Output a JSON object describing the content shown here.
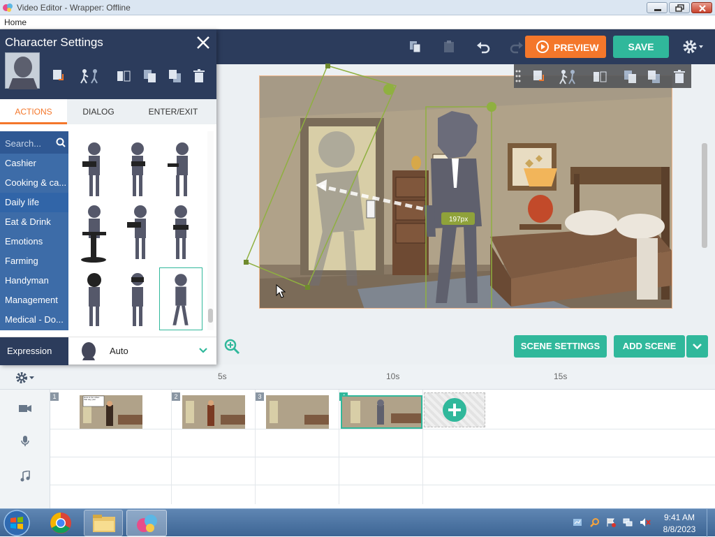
{
  "window": {
    "title": "Video Editor - Wrapper: Offline"
  },
  "menu": {
    "home": "Home"
  },
  "toolbar": {
    "preview_label": "PREVIEW",
    "save_label": "SAVE"
  },
  "panel": {
    "title": "Character Settings",
    "tabs": [
      "ACTIONS",
      "DIALOG",
      "ENTER/EXIT"
    ],
    "search_placeholder": "Search...",
    "categories": [
      "Cashier",
      "Cooking & ca...",
      "Daily life",
      "Eat & Drink",
      "Emotions",
      "Farming",
      "Handyman",
      "Management",
      "Medical - Do..."
    ],
    "selected_category": "Daily life",
    "expression_label": "Expression",
    "expression_value": "Auto"
  },
  "stage": {
    "distance_label": "197px",
    "scene_settings_label": "SCENE SETTINGS",
    "add_scene_label": "ADD SCENE"
  },
  "timeline": {
    "ticks": [
      "5s",
      "10s",
      "15s"
    ],
    "scenes": [
      {
        "number": "1",
        "note": "How to fun video that say your"
      },
      {
        "number": "2"
      },
      {
        "number": "3"
      },
      {
        "number": "4",
        "selected": true
      }
    ]
  },
  "taskbar": {
    "time": "9:41 AM",
    "date": "8/8/2023"
  },
  "colors": {
    "accent_orange": "#f4772b",
    "accent_teal": "#30b89b",
    "navy": "#2c3c5c",
    "category_blue": "#3d6ca8"
  }
}
